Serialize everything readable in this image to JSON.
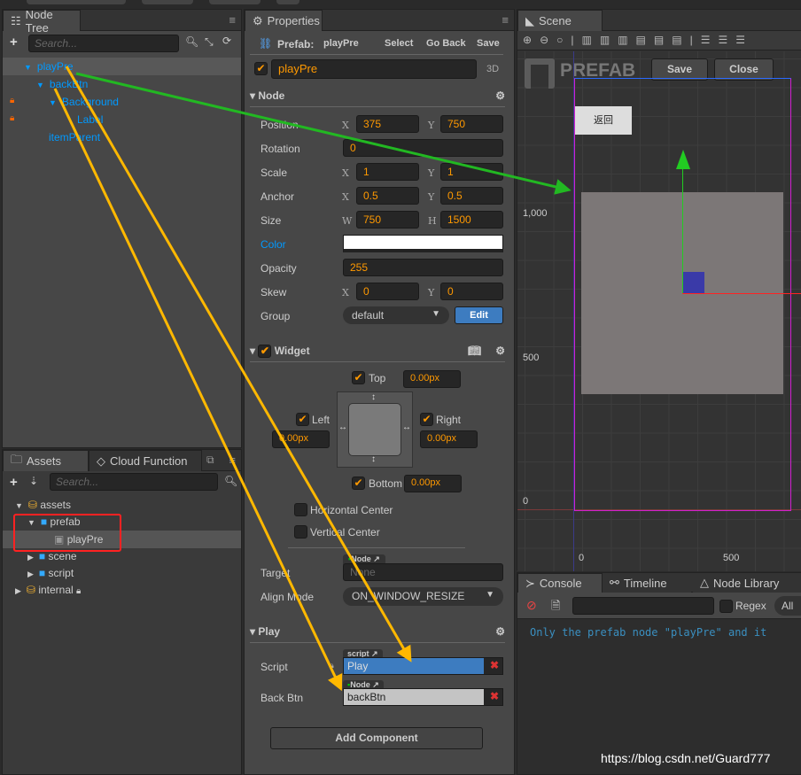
{
  "node_tree": {
    "title": "Node Tree",
    "search_placeholder": "Search...",
    "items": [
      {
        "label": "playPre",
        "depth": 0,
        "expanded": true,
        "locked": false
      },
      {
        "label": "backBtn",
        "depth": 1,
        "expanded": true,
        "locked": false
      },
      {
        "label": "Background",
        "depth": 2,
        "expanded": true,
        "locked": true
      },
      {
        "label": "Label",
        "depth": 3,
        "locked": true
      },
      {
        "label": "itemParent",
        "depth": 1,
        "locked": false
      }
    ]
  },
  "assets": {
    "tabs": [
      "Assets",
      "Cloud Function"
    ],
    "search_placeholder": "Search...",
    "items": [
      {
        "label": "assets",
        "icon": "db-icon"
      },
      {
        "label": "prefab",
        "icon": "folder-icon"
      },
      {
        "label": "playPre",
        "icon": "prefab-icon"
      },
      {
        "label": "scene",
        "icon": "folder-icon"
      },
      {
        "label": "script",
        "icon": "folder-icon"
      },
      {
        "label": "internal",
        "icon": "db-icon"
      }
    ]
  },
  "properties": {
    "title": "Properties",
    "prefab_label": "Prefab:",
    "prefab_name": "playPre",
    "select": "Select",
    "go_back": "Go Back",
    "save": "Save",
    "node_name": "playPre",
    "mode_3d": "3D",
    "node_section": "Node",
    "position": {
      "label": "Position",
      "x": "375",
      "y": "750"
    },
    "rotation": {
      "label": "Rotation",
      "value": "0"
    },
    "scale": {
      "label": "Scale",
      "x": "1",
      "y": "1"
    },
    "anchor": {
      "label": "Anchor",
      "x": "0.5",
      "y": "0.5"
    },
    "size": {
      "label": "Size",
      "w": "750",
      "h": "1500"
    },
    "color": {
      "label": "Color",
      "value": "#ffffff"
    },
    "opacity": {
      "label": "Opacity",
      "value": "255"
    },
    "skew": {
      "label": "Skew",
      "x": "0",
      "y": "0"
    },
    "group": {
      "label": "Group",
      "value": "default",
      "edit": "Edit"
    },
    "axis": {
      "x": "X",
      "y": "Y",
      "w": "W",
      "h": "H"
    },
    "widget": {
      "title": "Widget",
      "top": "Top",
      "top_val": "0.00px",
      "left": "Left",
      "left_val": "0.00px",
      "right": "Right",
      "right_val": "0.00px",
      "bottom": "Bottom",
      "bottom_val": "0.00px",
      "hcenter": "Horizontal Center",
      "vcenter": "Vertical Center",
      "target_label": "Target",
      "target_tag": "Node",
      "target_value": "None",
      "align_label": "Align Mode",
      "align_value": "ON_WINDOW_RESIZE"
    },
    "play": {
      "title": "Play",
      "script_label": "Script",
      "script_tag": "script",
      "script_value": "Play",
      "backbtn_label": "Back Btn",
      "backbtn_tag": "Node",
      "backbtn_value": "backBtn"
    },
    "add_component": "Add Component"
  },
  "scene": {
    "title": "Scene",
    "watermark": "PREFAB",
    "save": "Save",
    "close": "Close",
    "button_text": "返回",
    "y_ticks": [
      "1,000",
      "500",
      "0"
    ],
    "x_ticks": [
      "0",
      "500"
    ]
  },
  "console": {
    "tabs": [
      "Console",
      "Timeline",
      "Node Library"
    ],
    "regex": "Regex",
    "level": "All",
    "message": "Only the prefab node \"playPre\" and it"
  },
  "watermark_text": "https://blog.csdn.net/Guard777",
  "colors": {
    "accent": "#f7931e",
    "link": "#0099ff",
    "selection": "#3d7cc0"
  }
}
